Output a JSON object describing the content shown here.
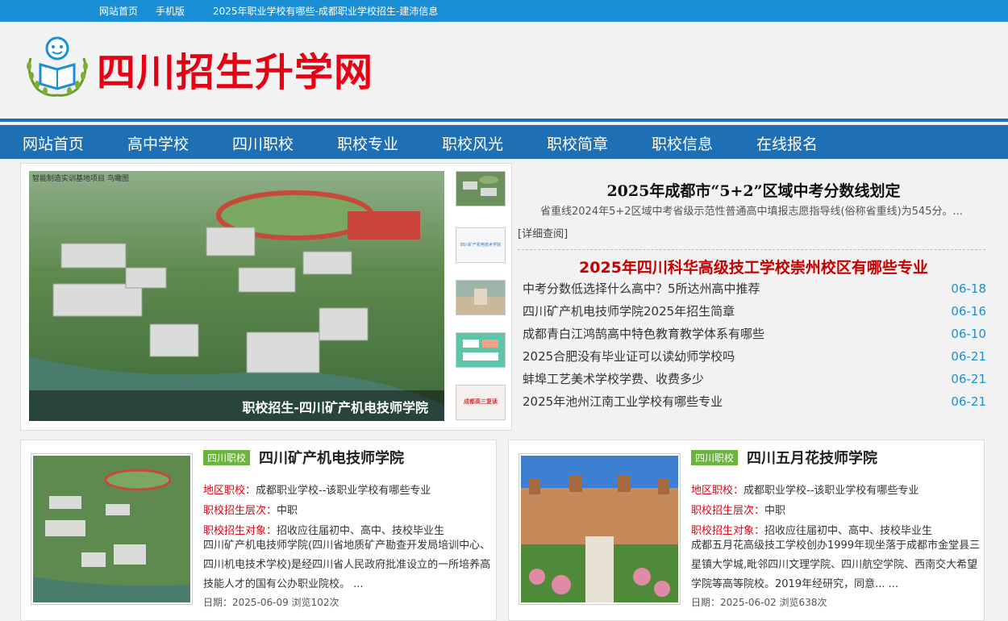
{
  "topbar": {
    "home": "网站首页",
    "mobile": "手机版",
    "notice": "2025年职业学校有哪些-成都职业学校招生-建沛信息"
  },
  "site": {
    "title": "四川招生升学网"
  },
  "nav": [
    "网站首页",
    "高中学校",
    "四川职校",
    "职校专业",
    "职校风光",
    "职校简章",
    "职校信息",
    "在线报名"
  ],
  "slider": {
    "caption": "职校招生-四川矿产机电技师学院",
    "image_label": "智能制造实训基地项目 鸟瞰图",
    "thumb_labels": [
      "四川矿产机电技术学院",
      "成都高三复读"
    ]
  },
  "news": {
    "headline": "2025年成都市“5+2”区域中考分数线划定",
    "summary": "省重线2024年5+2区域中考省级示范性普通高中填报志愿指导线(俗称省重线)为545分。...",
    "more": "[详细查阅]",
    "red_title": "2025年四川科华高级技工学校崇州校区有哪些专业",
    "items": [
      {
        "title": "中考分数低选择什么高中？5所达州高中推荐",
        "date": "06-18"
      },
      {
        "title": "四川矿产机电技师学院2025年招生简章",
        "date": "06-16"
      },
      {
        "title": "成都青白江鸿鹄高中特色教育教学体系有哪些",
        "date": "06-10"
      },
      {
        "title": "2025合肥没有毕业证可以读幼师学校吗",
        "date": "06-21"
      },
      {
        "title": "蚌埠工艺美术学校学费、收费多少",
        "date": "06-21"
      },
      {
        "title": "2025年池州江南工业学校有哪些专业",
        "date": "06-21"
      }
    ]
  },
  "cards": [
    {
      "tag": "四川职校",
      "title": "四川矿产机电技师学院",
      "region_label": "地区职校：",
      "region_value": "成都职业学校--该职业学校有哪些专业",
      "level_label": "职校招生层次：",
      "level_value": "中职",
      "target_label": "职校招生对象：",
      "target_value": "招收应往届初中、高中、技校毕业生",
      "desc": "四川矿产机电技师学院(四川省地质矿产勘查开发局培训中心、四川机电技术学校)是经四川省人民政府批准设立的一所培养高技能人才的国有公办职业院校。 ...",
      "meta": "日期：2025-06-09   浏览102次"
    },
    {
      "tag": "四川职校",
      "title": "四川五月花技师学院",
      "region_label": "地区职校：",
      "region_value": "成都职业学校--该职业学校有哪些专业",
      "level_label": "职校招生层次：",
      "level_value": "中职",
      "target_label": "职校招生对象：",
      "target_value": "招收应往届初中、高中、技校毕业生",
      "desc": "成都五月花高级技工学校创办1999年现坐落于成都市金堂县三星镇大学城,毗邻四川文理学院、四川航空学院、西南交大希望学院等高等院校。2019年经研究，同意... ...",
      "meta": "日期：2025-06-02   浏览638次"
    }
  ],
  "colors": {
    "topbar": "#1b8fd6",
    "nav": "#1f6fb5",
    "brand_red": "#e60012",
    "tag_green": "#6cb33f"
  }
}
